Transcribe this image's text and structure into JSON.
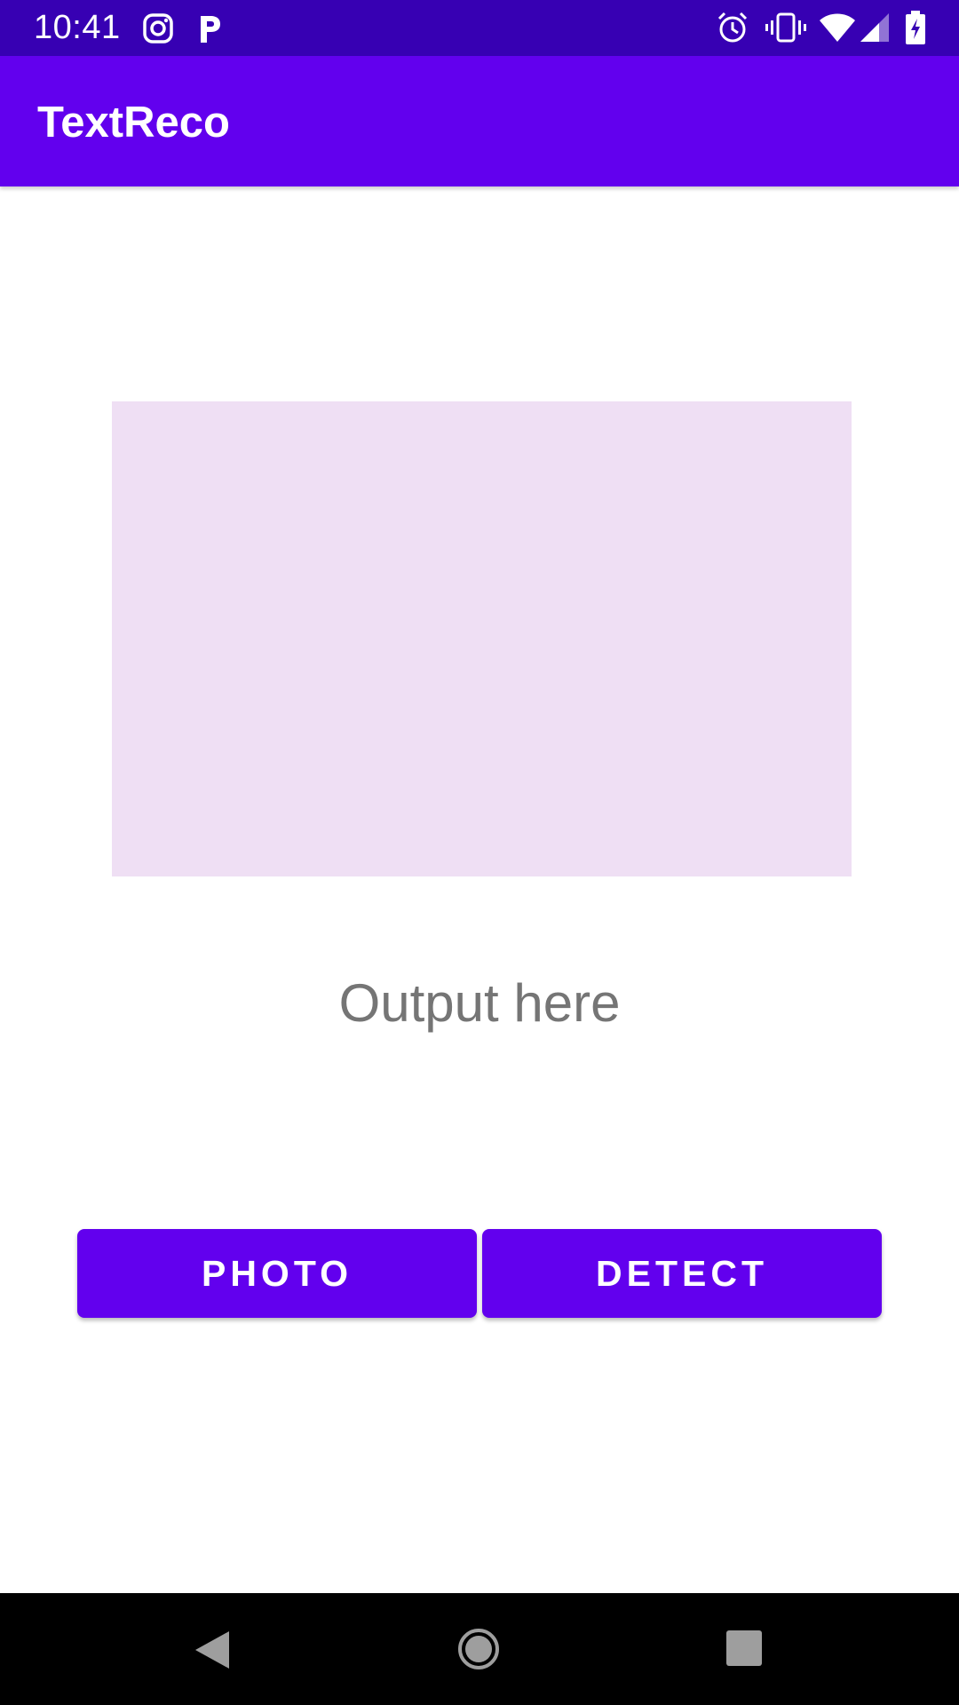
{
  "status_bar": {
    "time": "10:41",
    "icons": [
      "instagram-icon",
      "p-app-icon",
      "alarm-icon",
      "vibrate-icon",
      "wifi-icon",
      "signal-icon",
      "battery-charging-icon"
    ]
  },
  "app_bar": {
    "title": "TextReco"
  },
  "main": {
    "image_placeholder_color": "#efdff4",
    "output_text": "Output here",
    "photo_button_label": "PHOTO",
    "detect_button_label": "DETECT"
  },
  "nav_bar": {
    "icons": [
      "back-icon",
      "home-icon",
      "recents-icon"
    ]
  },
  "colors": {
    "status_bar": "#3700b3",
    "primary": "#6200ee",
    "placeholder": "#efdff4",
    "output_text": "#757575"
  }
}
